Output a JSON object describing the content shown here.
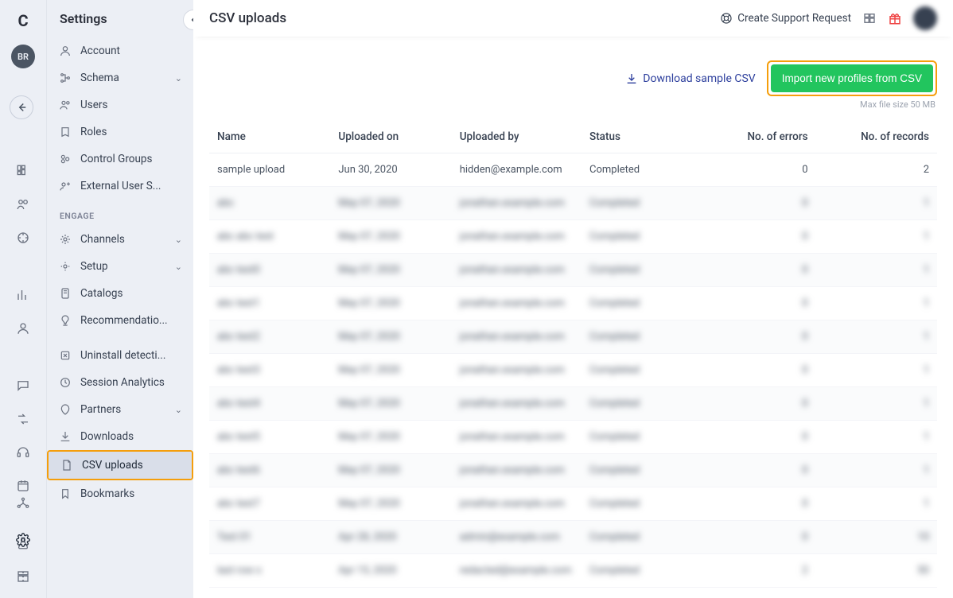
{
  "rail": {
    "logo": "C",
    "avatar": "BR"
  },
  "sidebar": {
    "title": "Settings",
    "section_engage": "ENGAGE",
    "items": {
      "account": "Account",
      "schema": "Schema",
      "users": "Users",
      "roles": "Roles",
      "control_groups": "Control Groups",
      "external_user_segments": "External User S...",
      "channels": "Channels",
      "setup": "Setup",
      "catalogs": "Catalogs",
      "recommendations": "Recommendatio...",
      "uninstall_detection": "Uninstall detecti...",
      "session_analytics": "Session Analytics",
      "partners": "Partners",
      "downloads": "Downloads",
      "csv_uploads": "CSV uploads",
      "bookmarks": "Bookmarks"
    }
  },
  "topbar": {
    "page_title": "CSV uploads",
    "support": "Create Support Request"
  },
  "actions": {
    "download_sample": "Download sample CSV",
    "import_btn": "Import new profiles from CSV",
    "hint": "Max file size 50 MB"
  },
  "table": {
    "headers": {
      "name": "Name",
      "uploaded_on": "Uploaded on",
      "uploaded_by": "Uploaded by",
      "status": "Status",
      "errors": "No. of errors",
      "records": "No. of records"
    },
    "rows": [
      {
        "name": "sample upload",
        "uploaded_on": "Jun 30, 2020",
        "uploaded_by": "hidden@example.com",
        "status": "Completed",
        "errors": "0",
        "records": "2",
        "blurred": false
      },
      {
        "name": "abc",
        "uploaded_on": "May 07, 2020",
        "uploaded_by": "jonathan.example.com",
        "status": "Completed",
        "errors": "0",
        "records": "1",
        "blurred": true
      },
      {
        "name": "abc abc test",
        "uploaded_on": "May 07, 2020",
        "uploaded_by": "jonathan.example.com",
        "status": "Completed",
        "errors": "0",
        "records": "1",
        "blurred": true
      },
      {
        "name": "abc test0",
        "uploaded_on": "May 07, 2020",
        "uploaded_by": "jonathan.example.com",
        "status": "Completed",
        "errors": "0",
        "records": "1",
        "blurred": true
      },
      {
        "name": "abc test1",
        "uploaded_on": "May 07, 2020",
        "uploaded_by": "jonathan.example.com",
        "status": "Completed",
        "errors": "0",
        "records": "1",
        "blurred": true
      },
      {
        "name": "abc test2",
        "uploaded_on": "May 07, 2020",
        "uploaded_by": "jonathan.example.com",
        "status": "Completed",
        "errors": "0",
        "records": "1",
        "blurred": true
      },
      {
        "name": "abc test3",
        "uploaded_on": "May 07, 2020",
        "uploaded_by": "jonathan.example.com",
        "status": "Completed",
        "errors": "0",
        "records": "1",
        "blurred": true
      },
      {
        "name": "abc test4",
        "uploaded_on": "May 07, 2020",
        "uploaded_by": "jonathan.example.com",
        "status": "Completed",
        "errors": "0",
        "records": "1",
        "blurred": true
      },
      {
        "name": "abc test5",
        "uploaded_on": "May 07, 2020",
        "uploaded_by": "jonathan.example.com",
        "status": "Completed",
        "errors": "0",
        "records": "1",
        "blurred": true
      },
      {
        "name": "abc test6",
        "uploaded_on": "May 07, 2020",
        "uploaded_by": "jonathan.example.com",
        "status": "Completed",
        "errors": "0",
        "records": "1",
        "blurred": true
      },
      {
        "name": "abc test7",
        "uploaded_on": "May 07, 2020",
        "uploaded_by": "jonathan.example.com",
        "status": "Completed",
        "errors": "0",
        "records": "1",
        "blurred": true
      },
      {
        "name": "Test 01",
        "uploaded_on": "Apr 28, 2020",
        "uploaded_by": "admin@example.com",
        "status": "Completed",
        "errors": "0",
        "records": "10",
        "blurred": true
      },
      {
        "name": "last row x",
        "uploaded_on": "Apr 15, 2020",
        "uploaded_by": "redacted@example.com",
        "status": "Completed",
        "errors": "2",
        "records": "50",
        "blurred": true
      }
    ]
  }
}
